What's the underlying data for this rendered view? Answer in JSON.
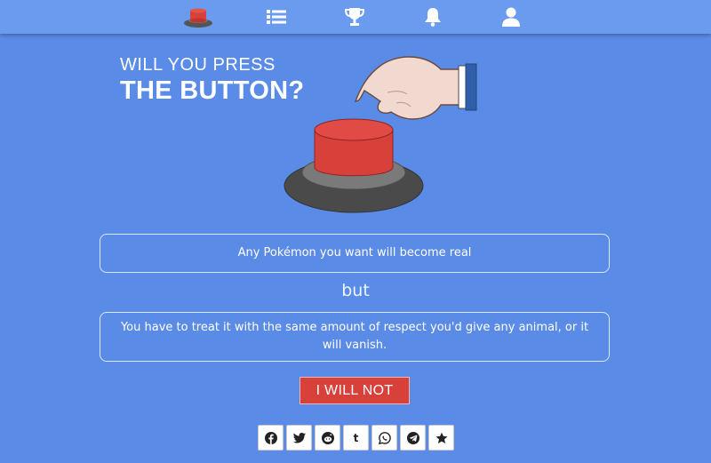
{
  "nav": {
    "items": [
      {
        "name": "nav-home",
        "icon": "red-button-icon"
      },
      {
        "name": "nav-list",
        "icon": "list-icon"
      },
      {
        "name": "nav-leaderboard",
        "icon": "trophy-icon"
      },
      {
        "name": "nav-notifications",
        "icon": "bell-icon"
      },
      {
        "name": "nav-profile",
        "icon": "user-icon"
      }
    ]
  },
  "header": {
    "line1": "WILL YOU PRESS",
    "line2": "THE BUTTON?"
  },
  "question": {
    "pro": "Any Pokémon you want will become real",
    "connector": "but",
    "con": "You have to treat it with the same amount of respect you'd give any animal, or it will vanish."
  },
  "actions": {
    "decline_label": "I WILL NOT"
  },
  "share": [
    {
      "network": "facebook",
      "icon": "facebook-icon"
    },
    {
      "network": "twitter",
      "icon": "twitter-icon"
    },
    {
      "network": "reddit",
      "icon": "reddit-icon"
    },
    {
      "network": "tumblr",
      "icon": "tumblr-icon"
    },
    {
      "network": "whatsapp",
      "icon": "whatsapp-icon"
    },
    {
      "network": "telegram",
      "icon": "telegram-icon"
    },
    {
      "network": "favorite",
      "icon": "star-icon"
    }
  ],
  "colors": {
    "background": "#5a8be6",
    "topbar": "#6b9bef",
    "button_red": "#d8403a"
  }
}
